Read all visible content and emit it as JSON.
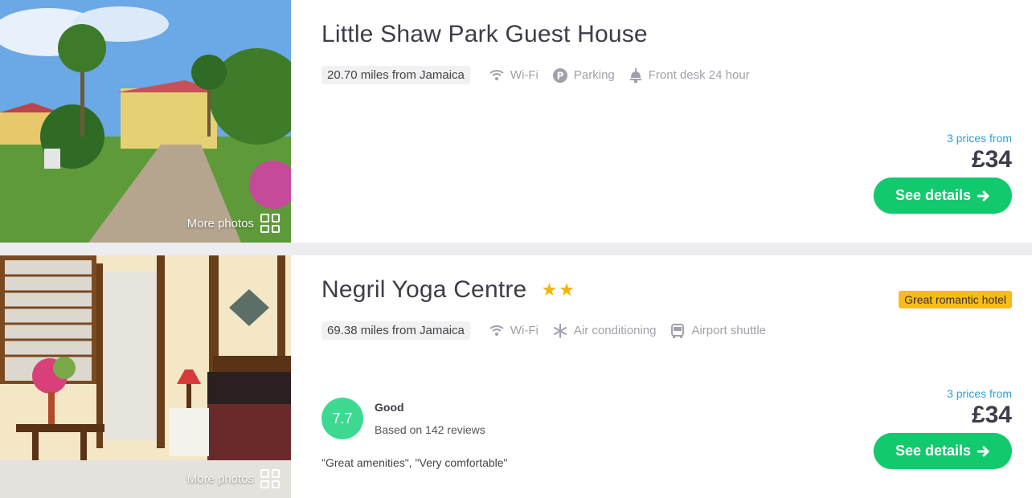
{
  "hotels": [
    {
      "name": "Little Shaw Park Guest House",
      "stars": "",
      "distance": "20.70 miles from Jamaica",
      "amenities": [
        "Wi-Fi",
        "Parking",
        "Front desk 24 hour"
      ],
      "amenity_icons": [
        "wifi-icon",
        "parking-icon",
        "bell-icon"
      ],
      "more_photos": "More photos",
      "prices_from": "3 prices from",
      "price": "£34",
      "button": "See details"
    },
    {
      "name": "Negril Yoga Centre",
      "stars": "★★",
      "badge": "Great romantic hotel",
      "distance": "69.38 miles from Jamaica",
      "amenities": [
        "Wi-Fi",
        "Air conditioning",
        "Airport shuttle"
      ],
      "amenity_icons": [
        "wifi-icon",
        "snowflake-icon",
        "bus-icon"
      ],
      "score": "7.7",
      "rating_label": "Good",
      "review_count": "Based on 142 reviews",
      "quotes": "\"Great amenities\", \"Very comfortable\"",
      "more_photos": "More photos",
      "prices_from": "3 prices from",
      "price": "£34",
      "button": "See details"
    }
  ],
  "colors": {
    "accent_green": "#12c96d",
    "price_blue": "#2f9fd6",
    "badge_yellow": "#f7bb1a",
    "score_green": "#3ed991",
    "star": "#f5b400"
  }
}
